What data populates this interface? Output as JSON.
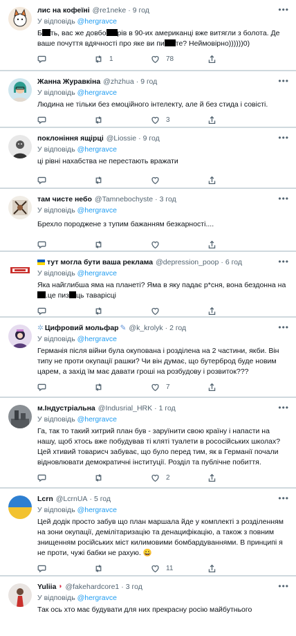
{
  "reply_prefix": "У відповідь",
  "reply_to": "@hergravce",
  "colors": {
    "link": "#1d9bf0",
    "muted": "#536471",
    "divider": "#cfd9de"
  },
  "icons": [
    "reply-icon",
    "retweet-icon",
    "like-icon",
    "share-icon",
    "more-icon"
  ],
  "tweets": [
    {
      "name": "лис на кофеїні",
      "handle": "@re1neke",
      "time": "9 год",
      "text_parts": [
        "Б",
        "ть, вас же довбо",
        "рів в 90-их американці вже витягли з болота. Де ваше почуття вдячності про яке ви пи",
        "те? Неймовірно))))))0)"
      ],
      "replies": "",
      "retweets": "1",
      "likes": "78"
    },
    {
      "name": "Жанна Журавкіна",
      "handle": "@zhzhua",
      "time": "9 год",
      "text": "Людина не тільки без емоційного інтелекту, але й без стида і совісті.",
      "replies": "",
      "retweets": "",
      "likes": "3"
    },
    {
      "name": "поклоніння ящірці",
      "handle": "@Liossie",
      "time": "9 год",
      "text": "ці рівні нахабства не перестають вражати",
      "replies": "",
      "retweets": "",
      "likes": ""
    },
    {
      "name": "там чисте небо",
      "handle": "@Tamnebochyste",
      "time": "3 год",
      "text": "Брехло породжене з тупим бажанням безкарності....",
      "replies": "",
      "retweets": "",
      "likes": ""
    },
    {
      "name": "тут могла бути ваша реклама",
      "handle": "@depression_poop",
      "time": "6 год",
      "text_parts": [
        "Яка найглибша яма на планеті? Яма в яку падає р*сня, вона бездонна на",
        ".це пиз",
        "ць таварісці"
      ],
      "replies": "",
      "retweets": "",
      "likes": ""
    },
    {
      "name": "Цифровий мольфар",
      "handle": "@k_krolyk",
      "time": "2 год",
      "text": "Германія після війни була окупована і розділена на 2 частини, якби. Він типу не проти окупації рашки? Чи він думає, що бутерброд буде новим царем, а захід їм має давати гроші на розбудову і розвиток???",
      "replies": "",
      "retweets": "",
      "likes": "7"
    },
    {
      "name": "м.Індустріальна",
      "handle": "@Indusrial_HRK",
      "time": "1 год",
      "text": "Га, так то такий хитрий план був - заруїнити свою країну і напасти на нашу, щоб хтось вже побудував ті кляті туалети в рососійських школах? Цей хтивий товарисч забуває, що було перед тим, як в Германії почали відновлювати демократичні інституції. Розділ та публічне побиття.",
      "replies": "",
      "retweets": "",
      "likes": "2"
    },
    {
      "name": "Lcrn",
      "handle": "@LcrnUA",
      "time": "5 год",
      "text": "Цей додік просто забув що план маршала йде у комплекті з розділенням на зони окупації, демілітаризацію та денацифікацію, а також з повним знищенням російських міст килимовими бомбардуваннями. В принципі я не проти, чужі бабки не рахую. 😀",
      "replies": "",
      "retweets": "",
      "likes": "11"
    },
    {
      "name": "Yuliia",
      "handle": "@fakehardcore1",
      "time": "3 год",
      "text": "Так ось хто має будувати для них прекрасну росію майбутнього",
      "replies": "",
      "retweets": "",
      "likes": ""
    }
  ]
}
